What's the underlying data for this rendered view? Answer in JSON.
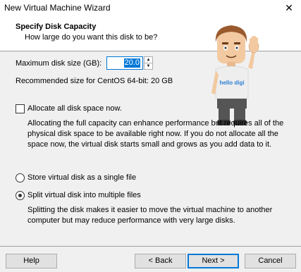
{
  "window": {
    "title": "New Virtual Machine Wizard",
    "close_glyph": "✕"
  },
  "header": {
    "title": "Specify Disk Capacity",
    "subtitle": "How large do you want this disk to be?"
  },
  "mascot": {
    "shirt_text": "hello digi"
  },
  "disk": {
    "size_label": "Maximum disk size (GB):",
    "size_value": "20.0",
    "recommended_text": "Recommended size for CentOS 64-bit: 20 GB"
  },
  "allocate": {
    "label": "Allocate all disk space now.",
    "checked": false,
    "description": "Allocating the full capacity can enhance performance but requires all of the physical disk space to be available right now. If you do not allocate all the space now, the virtual disk starts small and grows as you add data to it."
  },
  "storage": {
    "options": [
      {
        "label": "Store virtual disk as a single file",
        "selected": false
      },
      {
        "label": "Split virtual disk into multiple files",
        "selected": true
      }
    ],
    "split_description": "Splitting the disk makes it easier to move the virtual machine to another computer but may reduce performance with very large disks."
  },
  "footer": {
    "help": "Help",
    "back": "< Back",
    "next": "Next >",
    "cancel": "Cancel"
  },
  "colors": {
    "accent": "#0078d7",
    "dialog_background": "#f0f0f0",
    "button_face": "#e1e1e1"
  }
}
